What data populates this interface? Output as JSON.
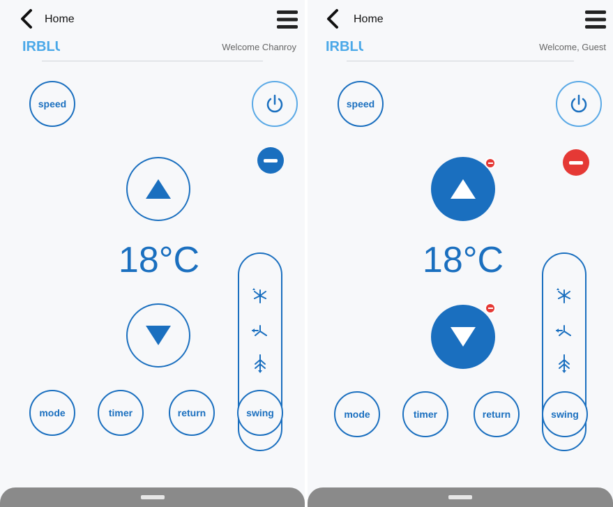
{
  "screens": [
    {
      "header": {
        "home_label": "Home",
        "welcome": "Welcome Chanroy"
      },
      "logo_text": "IRBLUE",
      "controls": {
        "speed": "speed",
        "mode": "mode",
        "timer": "timer",
        "return": "return",
        "swing": "swing",
        "temperature": "18°C"
      },
      "colors": {
        "accent": "#1a6fbf",
        "power_ring": "#5aa9e6",
        "minus_button": "#1a6fbf"
      }
    },
    {
      "header": {
        "home_label": "Home",
        "welcome": "Welcome, Guest"
      },
      "logo_text": "IRBLUE",
      "controls": {
        "speed": "speed",
        "mode": "mode",
        "timer": "timer",
        "return": "return",
        "swing": "swing",
        "temperature": "18°C"
      },
      "colors": {
        "accent": "#1a6fbf",
        "power_ring": "#5aa9e6",
        "minus_button": "#e53935",
        "badge": "#e53935"
      }
    }
  ],
  "icons": [
    "back-arrow-icon",
    "hamburger-menu-icon",
    "power-icon",
    "minus-icon",
    "up-arrow-icon",
    "down-arrow-icon",
    "swing-up-icon",
    "swing-middle-icon",
    "swing-down-icon"
  ]
}
